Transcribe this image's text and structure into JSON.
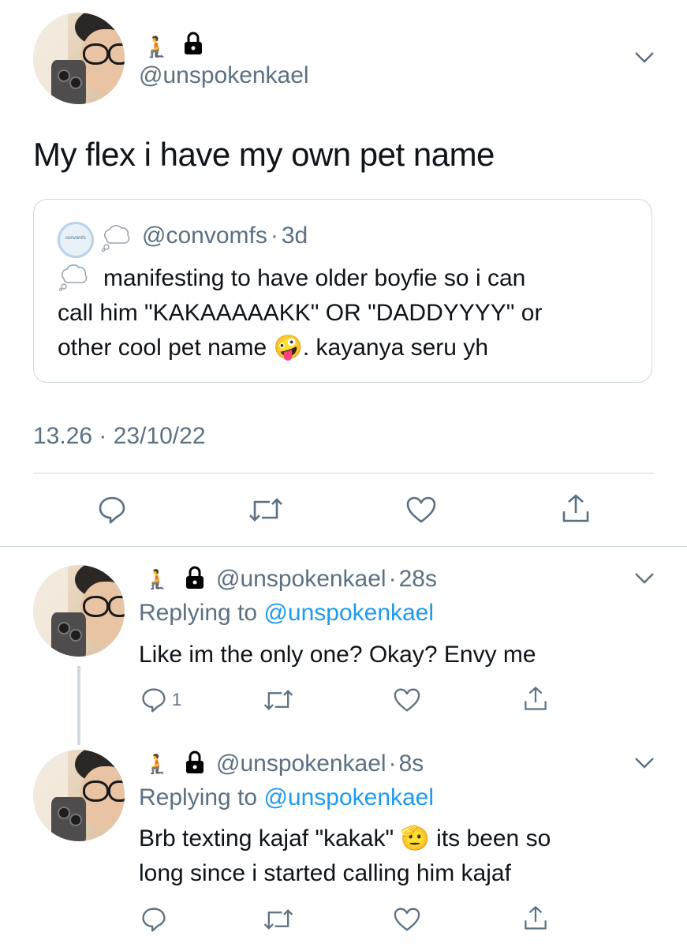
{
  "main_tweet": {
    "author_emoji": "🧎",
    "lock_icon": "lock-icon",
    "handle": "@unspokenkael",
    "text": "My flex i have my own pet name",
    "timestamp": "13.26 · 23/10/22"
  },
  "quoted_tweet": {
    "avatar_text": "convomfs",
    "handle": "@convomfs",
    "separator": "·",
    "time": "3d",
    "text_line1": "manifesting to have older boyfie so i can",
    "text_line2": "call him \"KAKAAAAAKK\" OR \"DADDYYYY\" or",
    "text_line3_pre": "other cool pet name",
    "text_line3_emoji": "🤪",
    "text_line3_post": ". kayanya seru yh"
  },
  "replies": [
    {
      "handle": "@unspokenkael",
      "separator": "·",
      "time": "28s",
      "replying_prefix": "Replying to",
      "replying_handle": "@unspokenkael",
      "text": "Like im the only one? Okay? Envy me",
      "reply_count": "1"
    },
    {
      "handle": "@unspokenkael",
      "separator": "·",
      "time": "8s",
      "replying_prefix": "Replying to",
      "replying_handle": "@unspokenkael",
      "text_line1_pre": "Brb texting kajaf \"kakak\"",
      "text_line1_emoji": "🫡",
      "text_line1_post": "its been so",
      "text_line2": "long since i started calling him kajaf",
      "reply_count": ""
    }
  ],
  "colors": {
    "link": "#1d9bf0",
    "muted": "#5b7083",
    "border": "#cfd9de"
  }
}
